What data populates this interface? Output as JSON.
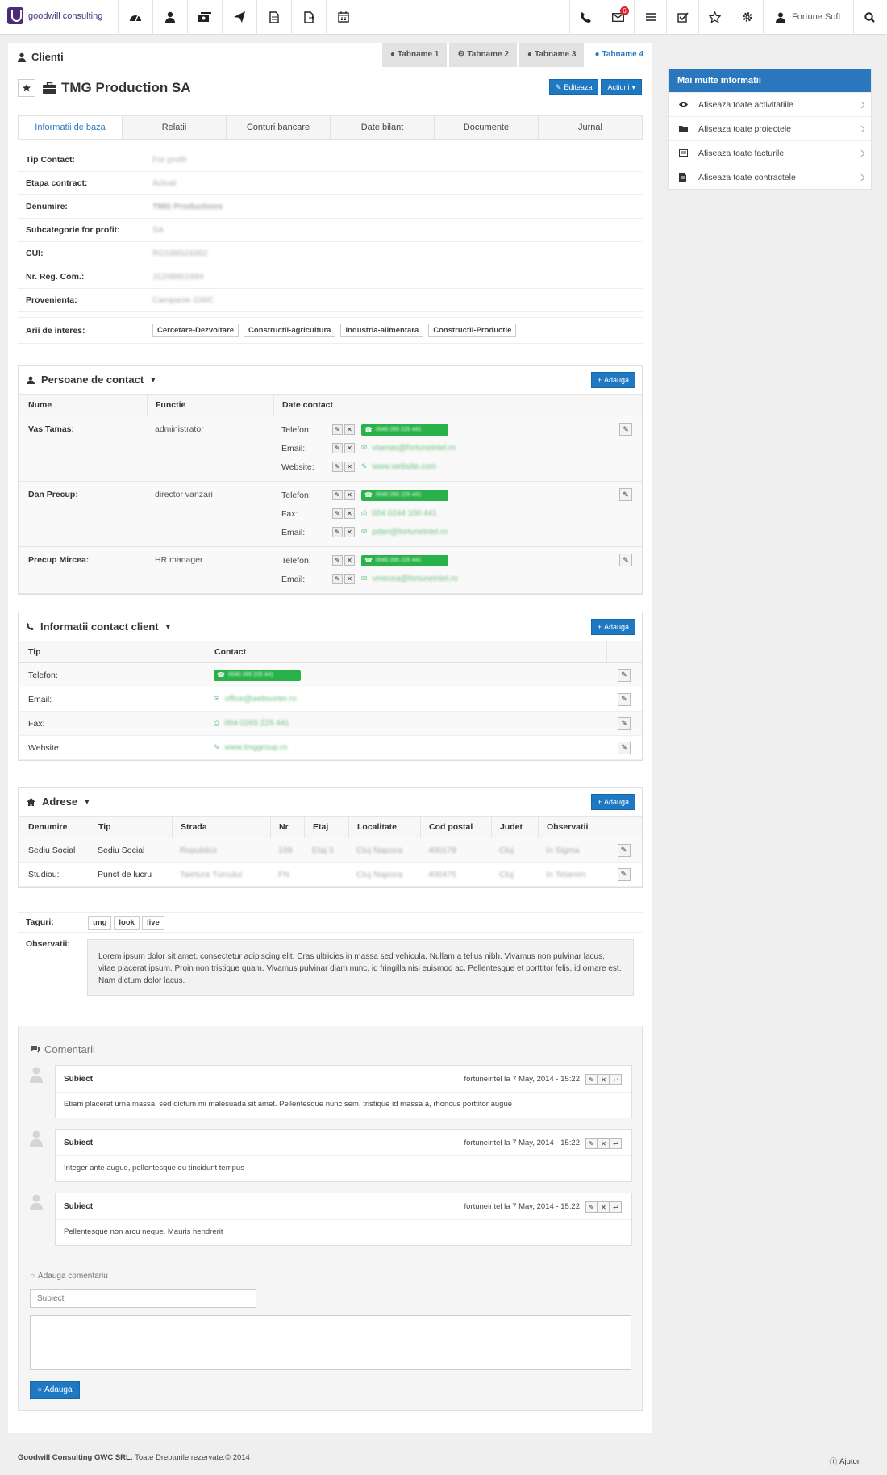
{
  "brand": {
    "name": "goodwill consulting"
  },
  "user": {
    "name": "Fortune Soft"
  },
  "nav": {
    "icons": [
      "dashboard-icon",
      "contacts-icon",
      "money-icon",
      "send-icon",
      "document-icon",
      "file-export-icon",
      "calendar-icon"
    ],
    "messages_badge": "6"
  },
  "page": {
    "title": "Clienti"
  },
  "top_tabs": [
    {
      "label": "Tabname 1"
    },
    {
      "label": "Tabname 2"
    },
    {
      "label": "Tabname 3"
    },
    {
      "label": "Tabname 4"
    }
  ],
  "entity": {
    "name": "TMG Production SA",
    "edit_label": "Editeaza",
    "actions_label": "Actiuni"
  },
  "sub_tabs": [
    {
      "label": "Informatii de baza"
    },
    {
      "label": "Relatii"
    },
    {
      "label": "Conturi bancare"
    },
    {
      "label": "Date bilant"
    },
    {
      "label": "Documente"
    },
    {
      "label": "Jurnal"
    }
  ],
  "basic_info": [
    {
      "label": "Tip Contact:",
      "value": "For profit"
    },
    {
      "label": "Etapa contract:",
      "value": "Actual"
    },
    {
      "label": "Denumire:",
      "value": "TMG Productions"
    },
    {
      "label": "Subcategorie for profit:",
      "value": "SA"
    },
    {
      "label": "CUI:",
      "value": "RO188524362"
    },
    {
      "label": "Nr. Reg. Com.:",
      "value": "J12/888/1994"
    },
    {
      "label": "Provenienta:",
      "value": "Campanie GWC"
    }
  ],
  "interests": {
    "label": "Arii de interes:",
    "tags": [
      "Cercetare-Dezvoltare",
      "Constructii-agricultura",
      "Industria-alimentara",
      "Constructii-Productie"
    ]
  },
  "contact_persons": {
    "title": "Persoane de contact",
    "add_label": "Adauga",
    "columns": [
      "Nume",
      "Functie",
      "Date contact"
    ],
    "rows": [
      {
        "name": "Vas Tamas:",
        "role": "administrator",
        "lines": [
          {
            "key": "Telefon:",
            "value": "0040 265 225 441",
            "kind": "phone"
          },
          {
            "key": "Email:",
            "value": "vtamas@fortuneintel.ro",
            "kind": "email"
          },
          {
            "key": "Website:",
            "value": "www.website.com",
            "kind": "web"
          }
        ]
      },
      {
        "name": "Dan Precup:",
        "role": "director vanzari",
        "lines": [
          {
            "key": "Telefon:",
            "value": "0040 265 225 441",
            "kind": "phone"
          },
          {
            "key": "Fax:",
            "value": "004 0244 100 441",
            "kind": "fax"
          },
          {
            "key": "Email:",
            "value": "pdan@fortuneintel.ro",
            "kind": "email"
          }
        ]
      },
      {
        "name": "Precup Mircea:",
        "role": "HR manager",
        "lines": [
          {
            "key": "Telefon:",
            "value": "0040 265 225 441",
            "kind": "phone"
          },
          {
            "key": "Email:",
            "value": "vmircea@fortuneintel.ro",
            "kind": "email"
          }
        ]
      }
    ]
  },
  "client_contact": {
    "title": "Informatii contact client",
    "add_label": "Adauga",
    "columns": [
      "Tip",
      "Contact"
    ],
    "rows": [
      {
        "type": "Telefon:",
        "value": "0040 265 225 441",
        "kind": "phone"
      },
      {
        "type": "Email:",
        "value": "office@websorter.ro",
        "kind": "email"
      },
      {
        "type": "Fax:",
        "value": "004 0265 225 441",
        "kind": "fax"
      },
      {
        "type": "Website:",
        "value": "www.tmggroup.ro",
        "kind": "web"
      }
    ]
  },
  "addresses": {
    "title": "Adrese",
    "add_label": "Adauga",
    "columns": [
      "Denumire",
      "Tip",
      "Strada",
      "Nr",
      "Etaj",
      "Localitate",
      "Cod postal",
      "Judet",
      "Observatii"
    ],
    "rows": [
      [
        "Sediu Social",
        "Sediu Social",
        "Republicii",
        "109",
        "Etaj 5",
        "Cluj Napoca",
        "400178",
        "Cluj",
        "In Sigma"
      ],
      [
        "Studiou:",
        "Punct de lucru",
        "Taietura Turcului",
        "FN",
        "",
        "Cluj Napoca",
        "400475",
        "Cluj",
        "In Tetarom"
      ]
    ]
  },
  "tags": {
    "label": "Taguri:",
    "items": [
      "tmg",
      "look",
      "live"
    ]
  },
  "observations": {
    "label": "Observatii:",
    "text": "Lorem ipsum dolor sit amet, consectetur adipiscing elit. Cras ultricies in massa sed vehicula. Nullam a tellus nibh. Vivamus non pulvinar lacus, vitae placerat ipsum. Proin non tristique quam. Vivamus pulvinar diam nunc, id fringilla nisi euismod ac. Pellentesque et porttitor felis, id ornare est. Nam dictum dolor lacus."
  },
  "comments": {
    "title": "Comentarii",
    "items": [
      {
        "subject": "Subiect",
        "meta": "fortuneintel la 7 May, 2014 - 15:22",
        "body": "Etiam placerat urna massa, sed dictum mi malesuada sit amet. Pellentesque nunc sem, tristique id massa a, rhoncus porttitor augue"
      },
      {
        "subject": "Subiect",
        "meta": "fortuneintel la 7 May, 2014 - 15:22",
        "body": "Integer ante augue, pellentesque eu tincidunt tempus"
      },
      {
        "subject": "Subiect",
        "meta": "fortuneintel la 7 May, 2014 - 15:22",
        "body": "Pellentesque non arcu neque. Mauris hendrerit"
      }
    ],
    "add_title": "Adauga comentariu",
    "subject_placeholder": "Subiect",
    "body_placeholder": "...",
    "submit_label": "Adauga"
  },
  "more_info": {
    "title": "Mai multe informatii",
    "items": [
      {
        "label": "Afiseaza toate activitatiile"
      },
      {
        "label": "Afiseaza toate proiectele"
      },
      {
        "label": "Afiseaza toate facturile"
      },
      {
        "label": "Afiseaza toate contractele"
      }
    ]
  },
  "footer": {
    "company": "Goodwill Consulting GWC SRL.",
    "rights": "Toate Drepturile rezervate.© 2014",
    "help_label": "Ajutor"
  },
  "colors": {
    "primary": "#1e78c2",
    "header_blue": "#2a77be",
    "green": "#2ab24a",
    "badge_red": "#d9232d"
  }
}
